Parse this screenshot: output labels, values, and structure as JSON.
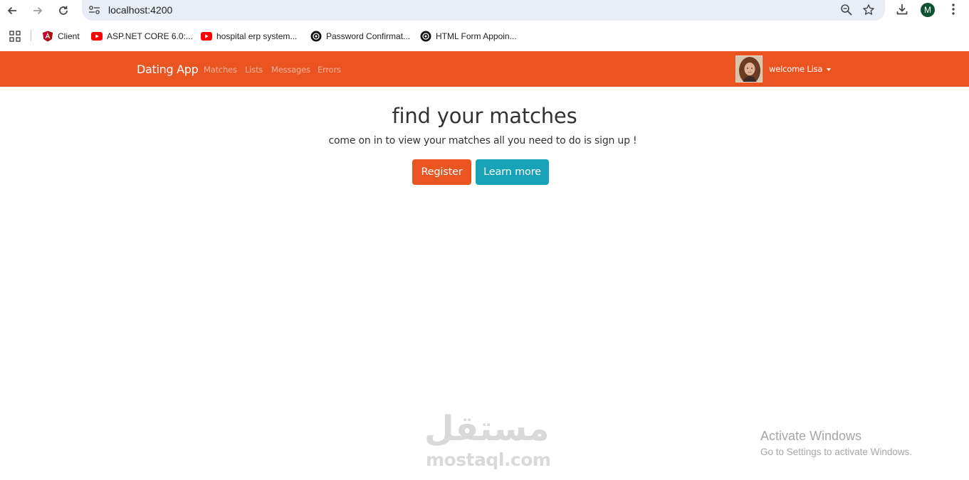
{
  "browser": {
    "url": "localhost:4200",
    "profile_initial": "M",
    "bookmarks": [
      {
        "label": "Client",
        "icon": "angular-icon"
      },
      {
        "label": "ASP.NET CORE 6.0:...",
        "icon": "youtube-icon"
      },
      {
        "label": "hospital erp system...",
        "icon": "youtube-icon"
      },
      {
        "label": "Password Confirmat...",
        "icon": "chatgpt-icon"
      },
      {
        "label": "HTML Form Appoin...",
        "icon": "chatgpt-icon"
      }
    ]
  },
  "navbar": {
    "brand": "Dating App",
    "links": [
      "Matches",
      "Lists",
      "Messages",
      "Errors"
    ],
    "welcome": "welcome Lisa",
    "color": "#e95420"
  },
  "hero": {
    "title": "find your matches",
    "subtitle": "come on in to view your matches all you need to do is sign up !",
    "register_label": "Register",
    "learn_more_label": "Learn more",
    "register_color": "#e95420",
    "learn_more_color": "#17a2b8"
  },
  "watermark": {
    "arabic": "مستقل",
    "latin": "mostaql.com"
  },
  "activation": {
    "title": "Activate Windows",
    "subtitle": "Go to Settings to activate Windows."
  }
}
